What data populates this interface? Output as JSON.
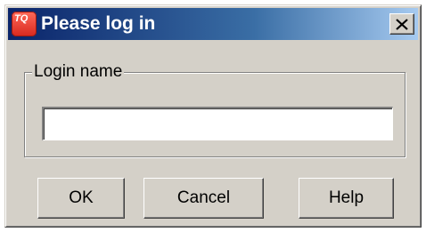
{
  "window": {
    "title": "Please log in",
    "app_icon": {
      "name": "tq-app-icon",
      "label": "TQ",
      "color": "#e8342a"
    },
    "title_gradient": [
      "#0a246a",
      "#a6caf0"
    ],
    "close_icon": "close-x-icon"
  },
  "login_group": {
    "legend": "Login name",
    "input_value": "",
    "input_placeholder": ""
  },
  "buttons": {
    "ok_label": "OK",
    "cancel_label": "Cancel",
    "help_label": "Help"
  },
  "colors": {
    "dialog_background": "#d4d0c8",
    "input_background": "#ffffff"
  }
}
